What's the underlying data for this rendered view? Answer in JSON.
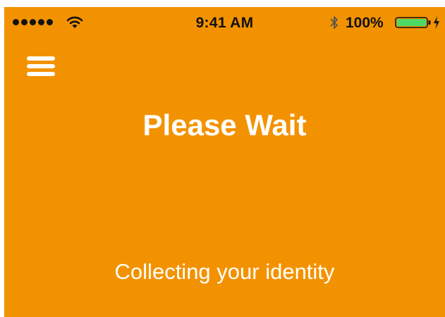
{
  "status_bar": {
    "time": "9:41 AM",
    "battery_percent": "100%",
    "signal_icon": "signal-dots-icon",
    "wifi_icon": "wifi-icon",
    "bluetooth_icon": "bluetooth-icon",
    "battery_icon": "battery-icon",
    "charging_icon": "charging-bolt-icon",
    "battery_level": 1.0
  },
  "header": {
    "menu_icon": "hamburger-menu-icon"
  },
  "main": {
    "title": "Please Wait",
    "message": "Collecting your identity"
  },
  "colors": {
    "background": "#f39200",
    "text": "#ffffff",
    "battery_fill": "#4cd964"
  }
}
